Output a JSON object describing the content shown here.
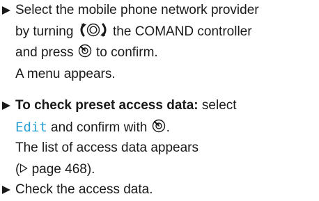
{
  "steps": [
    {
      "lines": [
        {
          "text": "Select the mobile phone network provider"
        },
        {
          "pre": "by turning ",
          "icon_a": "controller-turn-icon",
          "post": " the COMAND controller"
        },
        {
          "pre": "and press ",
          "icon_a": "controller-press-icon",
          "post": " to confirm."
        },
        {
          "text": "A menu appears."
        }
      ]
    },
    {
      "bold_prefix": "To check preset access data:",
      "line1_rest": " select",
      "menu_item": "Edit",
      "line2_rest": " and confirm with ",
      "icon_press": "controller-press-icon",
      "line2_end": ".",
      "line3": "The list of access data appears",
      "line4_pre": "(",
      "page_ref_icon": "page-reference-triangle-icon",
      "line4_post": " page 468)."
    },
    {
      "text": "Check the access data."
    }
  ],
  "colors": {
    "text": "#1a1a1a",
    "menu_item": "#2aa0d4"
  }
}
